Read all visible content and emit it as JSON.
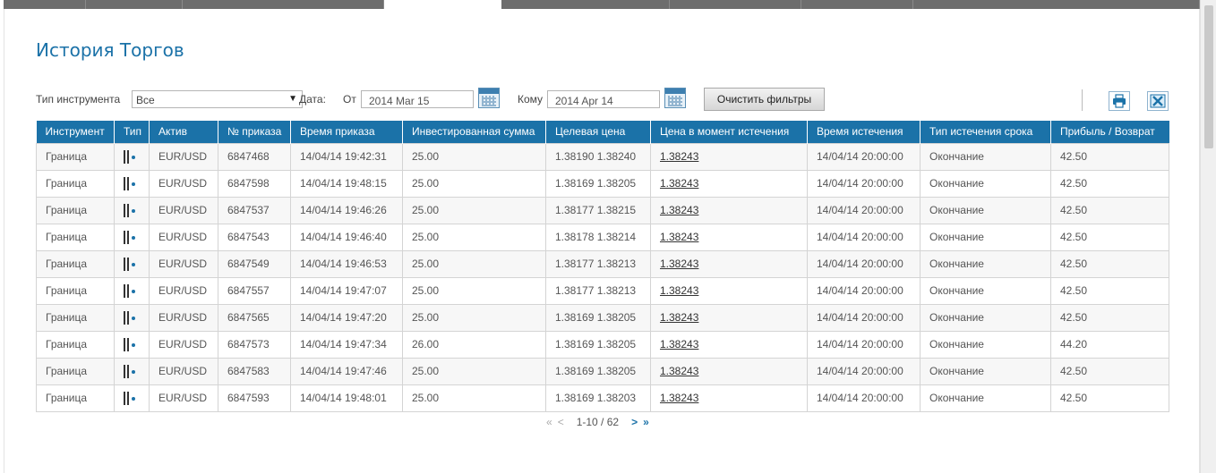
{
  "page": {
    "title": "История Торгов"
  },
  "filters": {
    "instrument_type_label": "Тип инструмента",
    "instrument_type_value": "Все",
    "date_label": "Дата:",
    "from_label": "От",
    "from_value": "2014 Mar 15",
    "to_label": "Кому",
    "to_value": "2014 Apr 14",
    "clear_button": "Очистить фильтры"
  },
  "toolbar": {
    "print_icon": "printer-icon",
    "export_icon": "excel-icon"
  },
  "table": {
    "columns": [
      "Инструмент",
      "Тип",
      "Актив",
      "№ приказа",
      "Время приказа",
      "Инвестированная сумма",
      "Целевая цена",
      "Цена в момент истечения",
      "Время истечения",
      "Тип истечения срока",
      "Прибыль / Возврат"
    ],
    "rows": [
      {
        "instrument": "Граница",
        "asset": "EUR/USD",
        "order": "6847468",
        "order_time": "14/04/14 19:42:31",
        "amount": "25.00",
        "target": "1.38190 1.38240",
        "expiry_price": "1.38243",
        "expiry_time": "14/04/14 20:00:00",
        "expiry_type": "Окончание",
        "profit": "42.50"
      },
      {
        "instrument": "Граница",
        "asset": "EUR/USD",
        "order": "6847598",
        "order_time": "14/04/14 19:48:15",
        "amount": "25.00",
        "target": "1.38169 1.38205",
        "expiry_price": "1.38243",
        "expiry_time": "14/04/14 20:00:00",
        "expiry_type": "Окончание",
        "profit": "42.50"
      },
      {
        "instrument": "Граница",
        "asset": "EUR/USD",
        "order": "6847537",
        "order_time": "14/04/14 19:46:26",
        "amount": "25.00",
        "target": "1.38177 1.38215",
        "expiry_price": "1.38243",
        "expiry_time": "14/04/14 20:00:00",
        "expiry_type": "Окончание",
        "profit": "42.50"
      },
      {
        "instrument": "Граница",
        "asset": "EUR/USD",
        "order": "6847543",
        "order_time": "14/04/14 19:46:40",
        "amount": "25.00",
        "target": "1.38178 1.38214",
        "expiry_price": "1.38243",
        "expiry_time": "14/04/14 20:00:00",
        "expiry_type": "Окончание",
        "profit": "42.50"
      },
      {
        "instrument": "Граница",
        "asset": "EUR/USD",
        "order": "6847549",
        "order_time": "14/04/14 19:46:53",
        "amount": "25.00",
        "target": "1.38177 1.38213",
        "expiry_price": "1.38243",
        "expiry_time": "14/04/14 20:00:00",
        "expiry_type": "Окончание",
        "profit": "42.50"
      },
      {
        "instrument": "Граница",
        "asset": "EUR/USD",
        "order": "6847557",
        "order_time": "14/04/14 19:47:07",
        "amount": "25.00",
        "target": "1.38177 1.38213",
        "expiry_price": "1.38243",
        "expiry_time": "14/04/14 20:00:00",
        "expiry_type": "Окончание",
        "profit": "42.50"
      },
      {
        "instrument": "Граница",
        "asset": "EUR/USD",
        "order": "6847565",
        "order_time": "14/04/14 19:47:20",
        "amount": "25.00",
        "target": "1.38169 1.38205",
        "expiry_price": "1.38243",
        "expiry_time": "14/04/14 20:00:00",
        "expiry_type": "Окончание",
        "profit": "42.50"
      },
      {
        "instrument": "Граница",
        "asset": "EUR/USD",
        "order": "6847573",
        "order_time": "14/04/14 19:47:34",
        "amount": "26.00",
        "target": "1.38169 1.38205",
        "expiry_price": "1.38243",
        "expiry_time": "14/04/14 20:00:00",
        "expiry_type": "Окончание",
        "profit": "44.20"
      },
      {
        "instrument": "Граница",
        "asset": "EUR/USD",
        "order": "6847583",
        "order_time": "14/04/14 19:47:46",
        "amount": "25.00",
        "target": "1.38169 1.38205",
        "expiry_price": "1.38243",
        "expiry_time": "14/04/14 20:00:00",
        "expiry_type": "Окончание",
        "profit": "42.50"
      },
      {
        "instrument": "Граница",
        "asset": "EUR/USD",
        "order": "6847593",
        "order_time": "14/04/14 19:48:01",
        "amount": "25.00",
        "target": "1.38169 1.38203",
        "expiry_price": "1.38243",
        "expiry_time": "14/04/14 20:00:00",
        "expiry_type": "Окончание",
        "profit": "42.50"
      }
    ]
  },
  "pagination": {
    "first": "«",
    "prev": "<",
    "range": "1-10 / 62",
    "next": ">",
    "last": "»"
  },
  "colors": {
    "accent": "#1b72a8",
    "header_bg": "#1b72a8",
    "topbar": "#6d6d6d"
  }
}
